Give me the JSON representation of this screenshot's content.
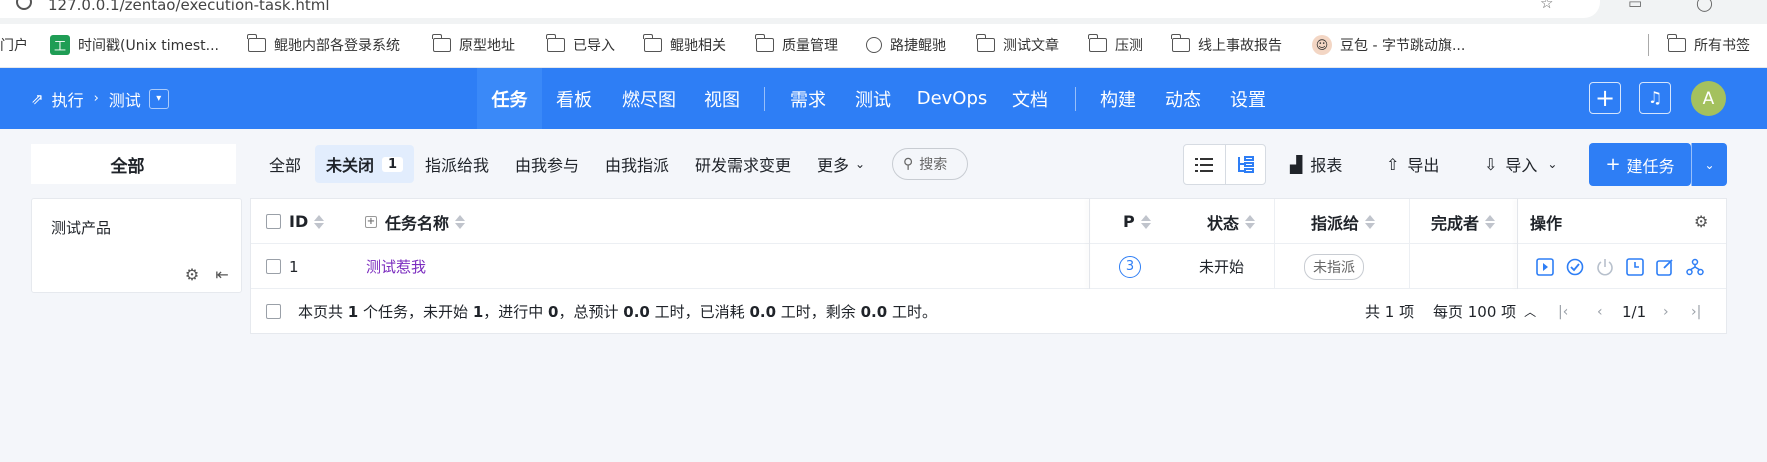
{
  "browser": {
    "url": "127.0.0.1/zentao/execution-task.html",
    "bookmarks": [
      "门户",
      "时间戳(Unix timest...",
      "鲲驰内部各登录系统",
      "原型地址",
      "已导入",
      "鲲驰相关",
      "质量管理",
      "路捷鲲驰",
      "测试文章",
      "压测",
      "线上事故报告",
      "豆包 - 字节跳动旗...",
      "所有书签"
    ]
  },
  "header": {
    "breadcrumb_root": "执行",
    "breadcrumb_current": "测试",
    "nav": [
      "任务",
      "看板",
      "燃尽图",
      "视图",
      "需求",
      "测试",
      "DevOps",
      "文档",
      "构建",
      "动态",
      "设置"
    ],
    "active_nav": "任务",
    "avatar_letter": "A",
    "accent_color": "#2e7ef5"
  },
  "toolbar": {
    "all_tab": "全部",
    "filters": [
      "全部",
      "未关闭",
      "指派给我",
      "由我参与",
      "由我指派",
      "研发需求变更",
      "更多"
    ],
    "active_filter": "未关闭",
    "active_count": "1",
    "search_placeholder": "搜索",
    "report": "报表",
    "export": "导出",
    "import": "导入",
    "create": "建任务"
  },
  "sidebar": {
    "product": "测试产品"
  },
  "table": {
    "headers": {
      "id": "ID",
      "name": "任务名称",
      "pri": "P",
      "status": "状态",
      "assigned": "指派给",
      "finished_by": "完成者",
      "actions": "操作"
    },
    "rows": [
      {
        "id": "1",
        "name": "测试惹我",
        "pri": "3",
        "status": "未开始",
        "assigned": "未指派",
        "finished_by": ""
      }
    ],
    "footer": {
      "prefix": "本页共",
      "count": "1",
      "mid1": "个任务，未开始",
      "not_started": "1",
      "mid2": "，进行中",
      "in_progress": "0",
      "mid3": "，总预计",
      "estimate": "0.0",
      "mid4": "工时，已消耗",
      "consumed": "0.0",
      "mid5": "工时，剩余",
      "left": "0.0",
      "suffix": "工时。"
    },
    "pager": {
      "total": "共 1 项",
      "per_page": "每页 100 项",
      "page": "1/1"
    }
  }
}
